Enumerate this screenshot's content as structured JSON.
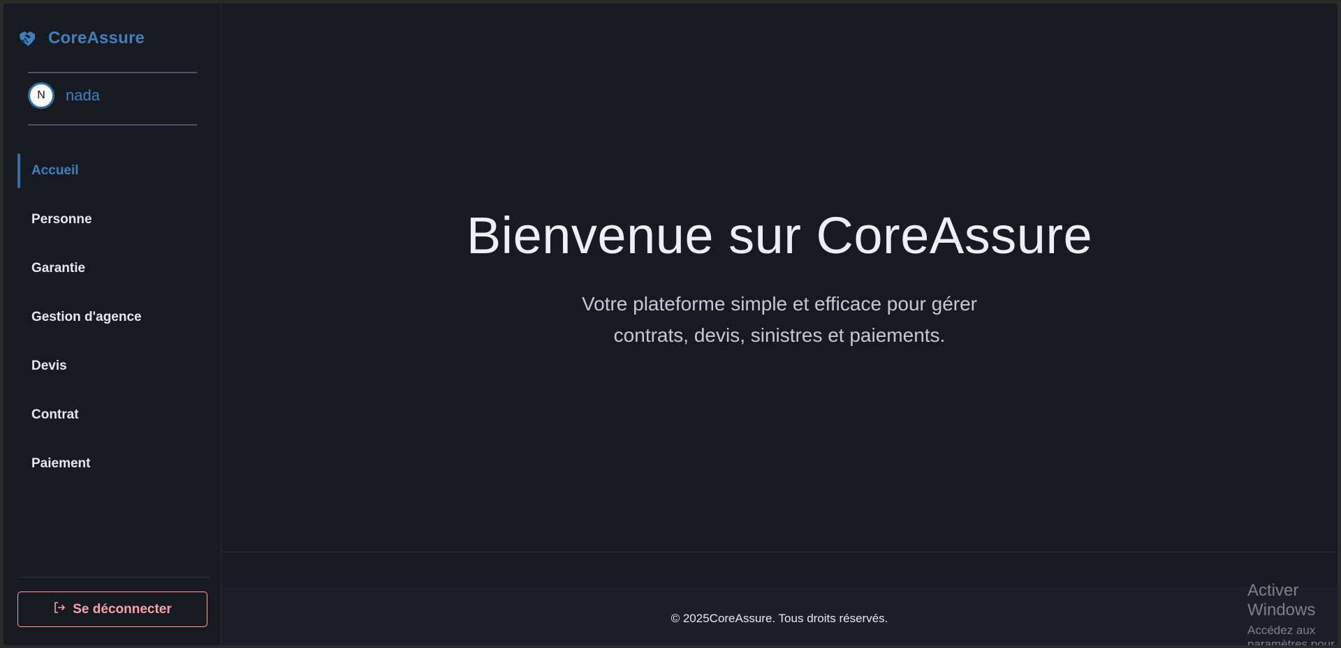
{
  "brand": {
    "name": "CoreAssure",
    "icon": "handshake-icon",
    "color": "#3b82c4"
  },
  "user": {
    "initial": "N",
    "name": "nada"
  },
  "nav": {
    "items": [
      {
        "label": "Accueil",
        "active": true
      },
      {
        "label": "Personne",
        "active": false
      },
      {
        "label": "Garantie",
        "active": false
      },
      {
        "label": "Gestion d'agence",
        "active": false
      },
      {
        "label": "Devis",
        "active": false
      },
      {
        "label": "Contrat",
        "active": false
      },
      {
        "label": "Paiement",
        "active": false
      }
    ]
  },
  "logout": {
    "label": "Se déconnecter",
    "icon": "logout-icon",
    "color": "#f3a3aa"
  },
  "hero": {
    "title": "Bienvenue sur CoreAssure",
    "subtitle_line1": "Votre plateforme simple et efficace pour gérer",
    "subtitle_line2": "contrats, devis, sinistres et paiements."
  },
  "footer": {
    "text": "© 2025CoreAssure. Tous droits réservés."
  },
  "windows_activation": {
    "title": "Activer Windows",
    "subtitle": "Accédez aux paramètres pour activer Windows."
  }
}
